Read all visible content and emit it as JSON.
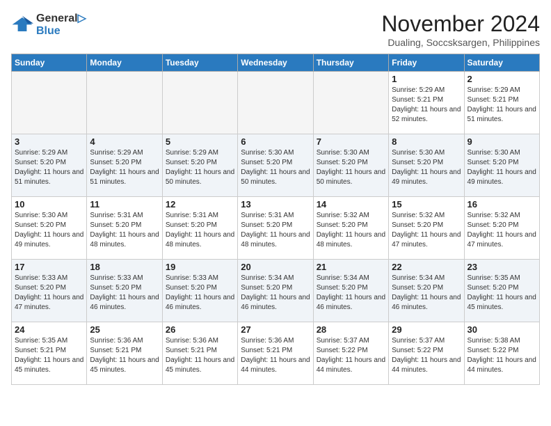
{
  "header": {
    "logo_line1": "General",
    "logo_line2": "Blue",
    "month": "November 2024",
    "location": "Dualing, Soccsksargen, Philippines"
  },
  "weekdays": [
    "Sunday",
    "Monday",
    "Tuesday",
    "Wednesday",
    "Thursday",
    "Friday",
    "Saturday"
  ],
  "weeks": [
    [
      {
        "day": "",
        "empty": true
      },
      {
        "day": "",
        "empty": true
      },
      {
        "day": "",
        "empty": true
      },
      {
        "day": "",
        "empty": true
      },
      {
        "day": "",
        "empty": true
      },
      {
        "day": "1",
        "sunrise": "5:29 AM",
        "sunset": "5:21 PM",
        "daylight": "11 hours and 52 minutes."
      },
      {
        "day": "2",
        "sunrise": "5:29 AM",
        "sunset": "5:21 PM",
        "daylight": "11 hours and 51 minutes."
      }
    ],
    [
      {
        "day": "3",
        "sunrise": "5:29 AM",
        "sunset": "5:20 PM",
        "daylight": "11 hours and 51 minutes."
      },
      {
        "day": "4",
        "sunrise": "5:29 AM",
        "sunset": "5:20 PM",
        "daylight": "11 hours and 51 minutes."
      },
      {
        "day": "5",
        "sunrise": "5:29 AM",
        "sunset": "5:20 PM",
        "daylight": "11 hours and 50 minutes."
      },
      {
        "day": "6",
        "sunrise": "5:30 AM",
        "sunset": "5:20 PM",
        "daylight": "11 hours and 50 minutes."
      },
      {
        "day": "7",
        "sunrise": "5:30 AM",
        "sunset": "5:20 PM",
        "daylight": "11 hours and 50 minutes."
      },
      {
        "day": "8",
        "sunrise": "5:30 AM",
        "sunset": "5:20 PM",
        "daylight": "11 hours and 49 minutes."
      },
      {
        "day": "9",
        "sunrise": "5:30 AM",
        "sunset": "5:20 PM",
        "daylight": "11 hours and 49 minutes."
      }
    ],
    [
      {
        "day": "10",
        "sunrise": "5:30 AM",
        "sunset": "5:20 PM",
        "daylight": "11 hours and 49 minutes."
      },
      {
        "day": "11",
        "sunrise": "5:31 AM",
        "sunset": "5:20 PM",
        "daylight": "11 hours and 48 minutes."
      },
      {
        "day": "12",
        "sunrise": "5:31 AM",
        "sunset": "5:20 PM",
        "daylight": "11 hours and 48 minutes."
      },
      {
        "day": "13",
        "sunrise": "5:31 AM",
        "sunset": "5:20 PM",
        "daylight": "11 hours and 48 minutes."
      },
      {
        "day": "14",
        "sunrise": "5:32 AM",
        "sunset": "5:20 PM",
        "daylight": "11 hours and 48 minutes."
      },
      {
        "day": "15",
        "sunrise": "5:32 AM",
        "sunset": "5:20 PM",
        "daylight": "11 hours and 47 minutes."
      },
      {
        "day": "16",
        "sunrise": "5:32 AM",
        "sunset": "5:20 PM",
        "daylight": "11 hours and 47 minutes."
      }
    ],
    [
      {
        "day": "17",
        "sunrise": "5:33 AM",
        "sunset": "5:20 PM",
        "daylight": "11 hours and 47 minutes."
      },
      {
        "day": "18",
        "sunrise": "5:33 AM",
        "sunset": "5:20 PM",
        "daylight": "11 hours and 46 minutes."
      },
      {
        "day": "19",
        "sunrise": "5:33 AM",
        "sunset": "5:20 PM",
        "daylight": "11 hours and 46 minutes."
      },
      {
        "day": "20",
        "sunrise": "5:34 AM",
        "sunset": "5:20 PM",
        "daylight": "11 hours and 46 minutes."
      },
      {
        "day": "21",
        "sunrise": "5:34 AM",
        "sunset": "5:20 PM",
        "daylight": "11 hours and 46 minutes."
      },
      {
        "day": "22",
        "sunrise": "5:34 AM",
        "sunset": "5:20 PM",
        "daylight": "11 hours and 46 minutes."
      },
      {
        "day": "23",
        "sunrise": "5:35 AM",
        "sunset": "5:20 PM",
        "daylight": "11 hours and 45 minutes."
      }
    ],
    [
      {
        "day": "24",
        "sunrise": "5:35 AM",
        "sunset": "5:21 PM",
        "daylight": "11 hours and 45 minutes."
      },
      {
        "day": "25",
        "sunrise": "5:36 AM",
        "sunset": "5:21 PM",
        "daylight": "11 hours and 45 minutes."
      },
      {
        "day": "26",
        "sunrise": "5:36 AM",
        "sunset": "5:21 PM",
        "daylight": "11 hours and 45 minutes."
      },
      {
        "day": "27",
        "sunrise": "5:36 AM",
        "sunset": "5:21 PM",
        "daylight": "11 hours and 44 minutes."
      },
      {
        "day": "28",
        "sunrise": "5:37 AM",
        "sunset": "5:22 PM",
        "daylight": "11 hours and 44 minutes."
      },
      {
        "day": "29",
        "sunrise": "5:37 AM",
        "sunset": "5:22 PM",
        "daylight": "11 hours and 44 minutes."
      },
      {
        "day": "30",
        "sunrise": "5:38 AM",
        "sunset": "5:22 PM",
        "daylight": "11 hours and 44 minutes."
      }
    ]
  ],
  "labels": {
    "sunrise": "Sunrise:",
    "sunset": "Sunset:",
    "daylight": "Daylight:"
  }
}
